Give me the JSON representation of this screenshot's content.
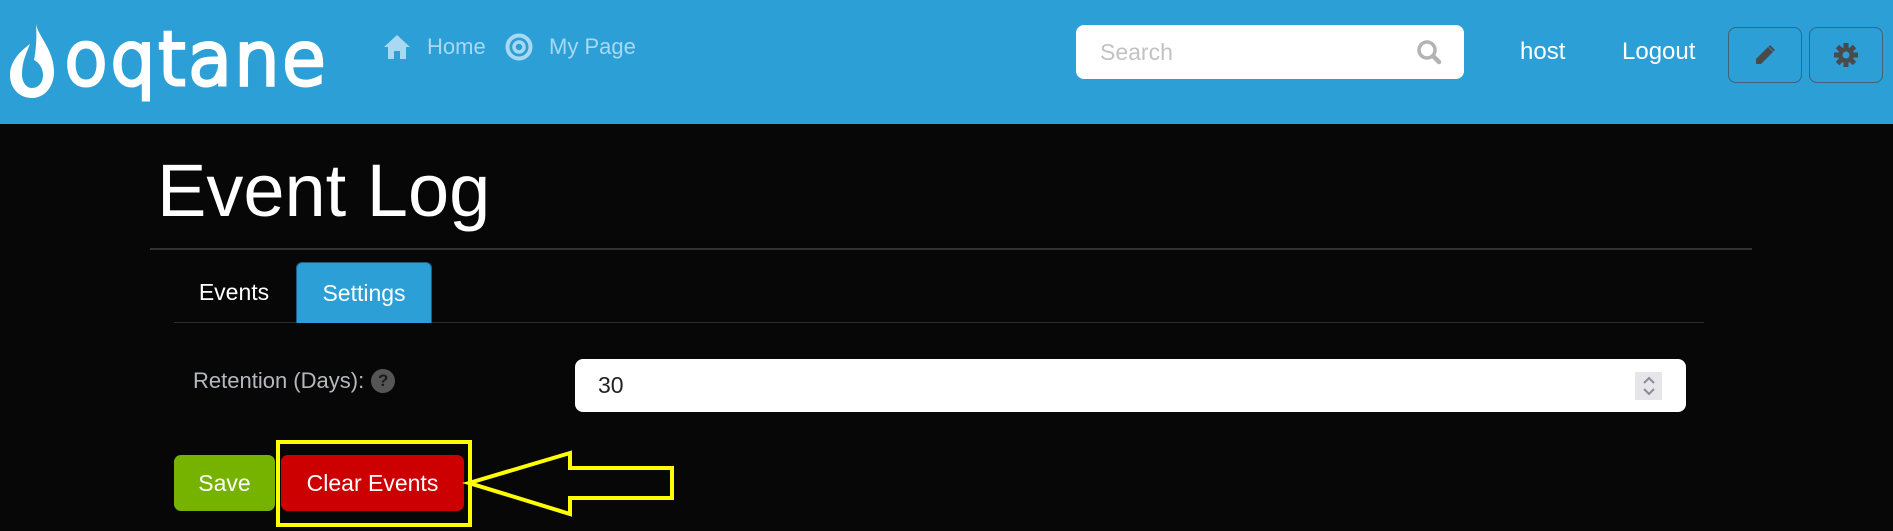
{
  "header": {
    "logo_text": "oqtane",
    "nav": [
      {
        "label": "Home",
        "icon": "home-icon"
      },
      {
        "label": "My Page",
        "icon": "target-icon"
      }
    ],
    "search": {
      "placeholder": "Search",
      "value": "",
      "icon": "search-icon"
    },
    "user": {
      "name": "host",
      "logout_label": "Logout"
    },
    "action_buttons": [
      {
        "name": "edit-mode-button",
        "icon": "pencil-icon"
      },
      {
        "name": "control-panel-button",
        "icon": "gear-icon"
      }
    ]
  },
  "page": {
    "title": "Event Log",
    "tabs": [
      {
        "label": "Events",
        "active": false
      },
      {
        "label": "Settings",
        "active": true
      }
    ],
    "settings": {
      "retention_label": "Retention (Days):",
      "help_icon": "?",
      "retention_value": "30"
    },
    "buttons": {
      "save_label": "Save",
      "clear_label": "Clear Events"
    }
  },
  "colors": {
    "header_bg": "#2b9fd6",
    "page_bg": "#070707",
    "active_tab": "#2b9fd6",
    "save": "#76b300",
    "danger": "#cc0000",
    "annotation": "#ffff00"
  },
  "annotation": {
    "type": "highlight-box-with-arrow",
    "target": "Clear Events"
  }
}
